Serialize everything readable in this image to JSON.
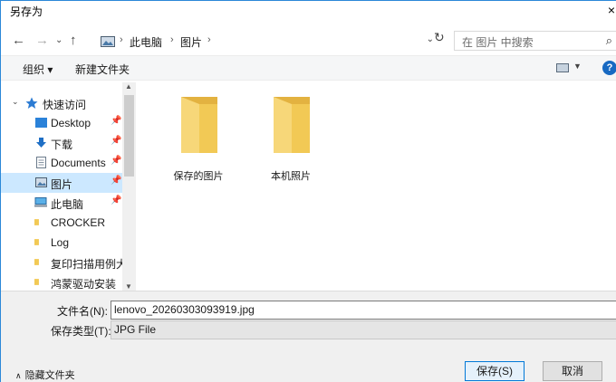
{
  "window": {
    "title": "另存为",
    "close_label": "×"
  },
  "address": {
    "crumbs": [
      "此电脑",
      "图片"
    ],
    "search_placeholder": "在 图片 中搜索"
  },
  "toolbar": {
    "organize_label": "组织 ▾",
    "new_folder_label": "新建文件夹"
  },
  "nav": {
    "items": [
      {
        "label": "快速访问",
        "icon": "star-icon"
      },
      {
        "label": "Desktop",
        "icon": "desktop-icon",
        "pinned": true
      },
      {
        "label": "下载",
        "icon": "download-icon",
        "pinned": true
      },
      {
        "label": "Documents",
        "icon": "document-icon",
        "pinned": true
      },
      {
        "label": "图片",
        "icon": "pictures-icon",
        "pinned": true,
        "selected": true
      },
      {
        "label": "此电脑",
        "icon": "computer-icon",
        "pinned": true
      },
      {
        "label": "CROCKER",
        "icon": "folder-icon"
      },
      {
        "label": "Log",
        "icon": "folder-icon"
      },
      {
        "label": "复印扫描用例大全",
        "icon": "folder-icon"
      },
      {
        "label": "鸿蒙驱动安装",
        "icon": "folder-icon"
      }
    ]
  },
  "content": {
    "folders": [
      {
        "label": "保存的图片"
      },
      {
        "label": "本机照片"
      }
    ]
  },
  "form": {
    "filename_label": "文件名(N):",
    "filename_value": "lenovo_20260303093919.jpg",
    "filetype_label": "保存类型(T):",
    "filetype_value": "JPG File"
  },
  "footer": {
    "hide_folders_label": "隐藏文件夹",
    "save_label": "保存(S)",
    "cancel_label": "取消"
  },
  "colors": {
    "accent": "#0078d7",
    "selected_bg": "#cce8ff",
    "folder": "#f2c955"
  }
}
